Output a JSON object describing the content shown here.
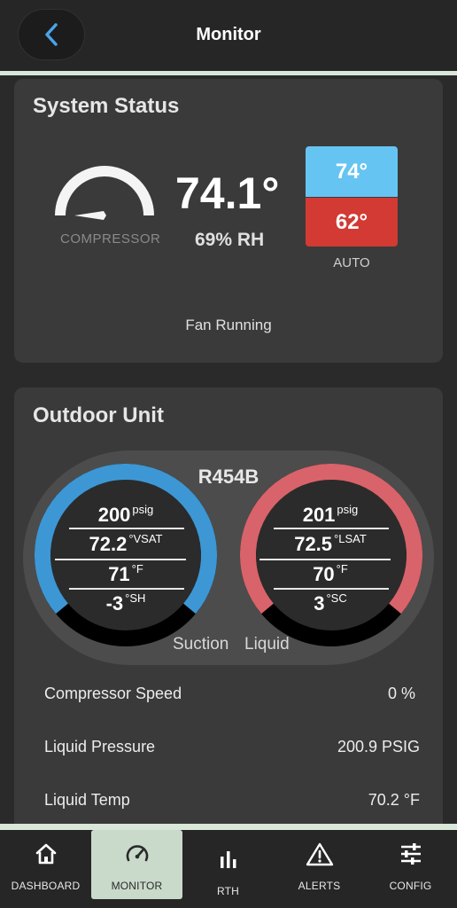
{
  "header": {
    "title": "Monitor"
  },
  "system_status": {
    "title": "System Status",
    "compressor_label": "COMPRESSOR",
    "indoor_temp": "74.1°",
    "humidity": "69% RH",
    "cool_setpoint": "74°",
    "heat_setpoint": "62°",
    "mode": "AUTO",
    "fan_status": "Fan Running",
    "colors": {
      "cool": "#66c4f2",
      "heat": "#d23a33"
    }
  },
  "outdoor_unit": {
    "title": "Outdoor Unit",
    "refrigerant": "R454B",
    "suction": {
      "label": "Suction",
      "color": "#3d97d4",
      "pressure": "200",
      "pressure_unit": "psig",
      "sat_temp": "72.2",
      "sat_unit": "°VSAT",
      "line_temp": "71",
      "line_unit": "°F",
      "superheat": "-3",
      "superheat_unit": "°SH"
    },
    "liquid": {
      "label": "Liquid",
      "color": "#d9636a",
      "pressure": "201",
      "pressure_unit": "psig",
      "sat_temp": "72.5",
      "sat_unit": "°LSAT",
      "line_temp": "70",
      "line_unit": "°F",
      "subcool": "3",
      "subcool_unit": "°SC"
    },
    "stats": [
      {
        "label": "Compressor Speed",
        "value": "0 %"
      },
      {
        "label": "Liquid Pressure",
        "value": "200.9 PSIG"
      },
      {
        "label": "Liquid Temp",
        "value": "70.2 °F"
      }
    ]
  },
  "nav": {
    "items": [
      {
        "label": "DASHBOARD",
        "icon": "home-icon"
      },
      {
        "label": "MONITOR",
        "icon": "gauge-icon",
        "active": true
      },
      {
        "label": "RTH",
        "icon": "bar-chart-icon"
      },
      {
        "label": "ALERTS",
        "icon": "warning-icon"
      },
      {
        "label": "CONFIG",
        "icon": "sliders-icon"
      }
    ]
  }
}
